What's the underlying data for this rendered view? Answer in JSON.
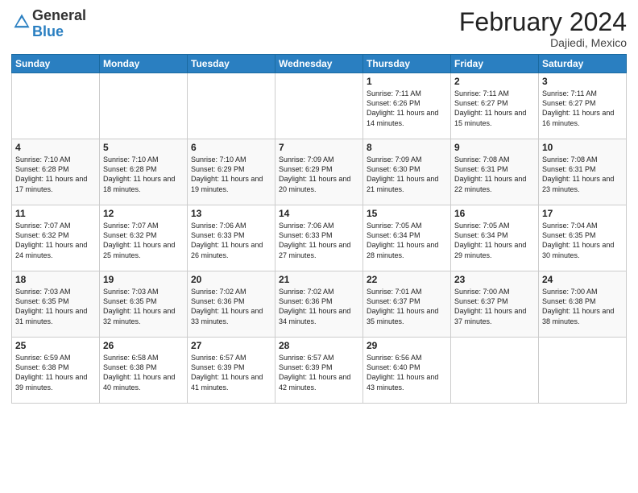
{
  "header": {
    "logo_general": "General",
    "logo_blue": "Blue",
    "month_title": "February 2024",
    "location": "Dajiedi, Mexico"
  },
  "days_of_week": [
    "Sunday",
    "Monday",
    "Tuesday",
    "Wednesday",
    "Thursday",
    "Friday",
    "Saturday"
  ],
  "weeks": [
    [
      {
        "day": "",
        "info": ""
      },
      {
        "day": "",
        "info": ""
      },
      {
        "day": "",
        "info": ""
      },
      {
        "day": "",
        "info": ""
      },
      {
        "day": "1",
        "info": "Sunrise: 7:11 AM\nSunset: 6:26 PM\nDaylight: 11 hours and 14 minutes."
      },
      {
        "day": "2",
        "info": "Sunrise: 7:11 AM\nSunset: 6:27 PM\nDaylight: 11 hours and 15 minutes."
      },
      {
        "day": "3",
        "info": "Sunrise: 7:11 AM\nSunset: 6:27 PM\nDaylight: 11 hours and 16 minutes."
      }
    ],
    [
      {
        "day": "4",
        "info": "Sunrise: 7:10 AM\nSunset: 6:28 PM\nDaylight: 11 hours and 17 minutes."
      },
      {
        "day": "5",
        "info": "Sunrise: 7:10 AM\nSunset: 6:28 PM\nDaylight: 11 hours and 18 minutes."
      },
      {
        "day": "6",
        "info": "Sunrise: 7:10 AM\nSunset: 6:29 PM\nDaylight: 11 hours and 19 minutes."
      },
      {
        "day": "7",
        "info": "Sunrise: 7:09 AM\nSunset: 6:29 PM\nDaylight: 11 hours and 20 minutes."
      },
      {
        "day": "8",
        "info": "Sunrise: 7:09 AM\nSunset: 6:30 PM\nDaylight: 11 hours and 21 minutes."
      },
      {
        "day": "9",
        "info": "Sunrise: 7:08 AM\nSunset: 6:31 PM\nDaylight: 11 hours and 22 minutes."
      },
      {
        "day": "10",
        "info": "Sunrise: 7:08 AM\nSunset: 6:31 PM\nDaylight: 11 hours and 23 minutes."
      }
    ],
    [
      {
        "day": "11",
        "info": "Sunrise: 7:07 AM\nSunset: 6:32 PM\nDaylight: 11 hours and 24 minutes."
      },
      {
        "day": "12",
        "info": "Sunrise: 7:07 AM\nSunset: 6:32 PM\nDaylight: 11 hours and 25 minutes."
      },
      {
        "day": "13",
        "info": "Sunrise: 7:06 AM\nSunset: 6:33 PM\nDaylight: 11 hours and 26 minutes."
      },
      {
        "day": "14",
        "info": "Sunrise: 7:06 AM\nSunset: 6:33 PM\nDaylight: 11 hours and 27 minutes."
      },
      {
        "day": "15",
        "info": "Sunrise: 7:05 AM\nSunset: 6:34 PM\nDaylight: 11 hours and 28 minutes."
      },
      {
        "day": "16",
        "info": "Sunrise: 7:05 AM\nSunset: 6:34 PM\nDaylight: 11 hours and 29 minutes."
      },
      {
        "day": "17",
        "info": "Sunrise: 7:04 AM\nSunset: 6:35 PM\nDaylight: 11 hours and 30 minutes."
      }
    ],
    [
      {
        "day": "18",
        "info": "Sunrise: 7:03 AM\nSunset: 6:35 PM\nDaylight: 11 hours and 31 minutes."
      },
      {
        "day": "19",
        "info": "Sunrise: 7:03 AM\nSunset: 6:35 PM\nDaylight: 11 hours and 32 minutes."
      },
      {
        "day": "20",
        "info": "Sunrise: 7:02 AM\nSunset: 6:36 PM\nDaylight: 11 hours and 33 minutes."
      },
      {
        "day": "21",
        "info": "Sunrise: 7:02 AM\nSunset: 6:36 PM\nDaylight: 11 hours and 34 minutes."
      },
      {
        "day": "22",
        "info": "Sunrise: 7:01 AM\nSunset: 6:37 PM\nDaylight: 11 hours and 35 minutes."
      },
      {
        "day": "23",
        "info": "Sunrise: 7:00 AM\nSunset: 6:37 PM\nDaylight: 11 hours and 37 minutes."
      },
      {
        "day": "24",
        "info": "Sunrise: 7:00 AM\nSunset: 6:38 PM\nDaylight: 11 hours and 38 minutes."
      }
    ],
    [
      {
        "day": "25",
        "info": "Sunrise: 6:59 AM\nSunset: 6:38 PM\nDaylight: 11 hours and 39 minutes."
      },
      {
        "day": "26",
        "info": "Sunrise: 6:58 AM\nSunset: 6:38 PM\nDaylight: 11 hours and 40 minutes."
      },
      {
        "day": "27",
        "info": "Sunrise: 6:57 AM\nSunset: 6:39 PM\nDaylight: 11 hours and 41 minutes."
      },
      {
        "day": "28",
        "info": "Sunrise: 6:57 AM\nSunset: 6:39 PM\nDaylight: 11 hours and 42 minutes."
      },
      {
        "day": "29",
        "info": "Sunrise: 6:56 AM\nSunset: 6:40 PM\nDaylight: 11 hours and 43 minutes."
      },
      {
        "day": "",
        "info": ""
      },
      {
        "day": "",
        "info": ""
      }
    ]
  ]
}
